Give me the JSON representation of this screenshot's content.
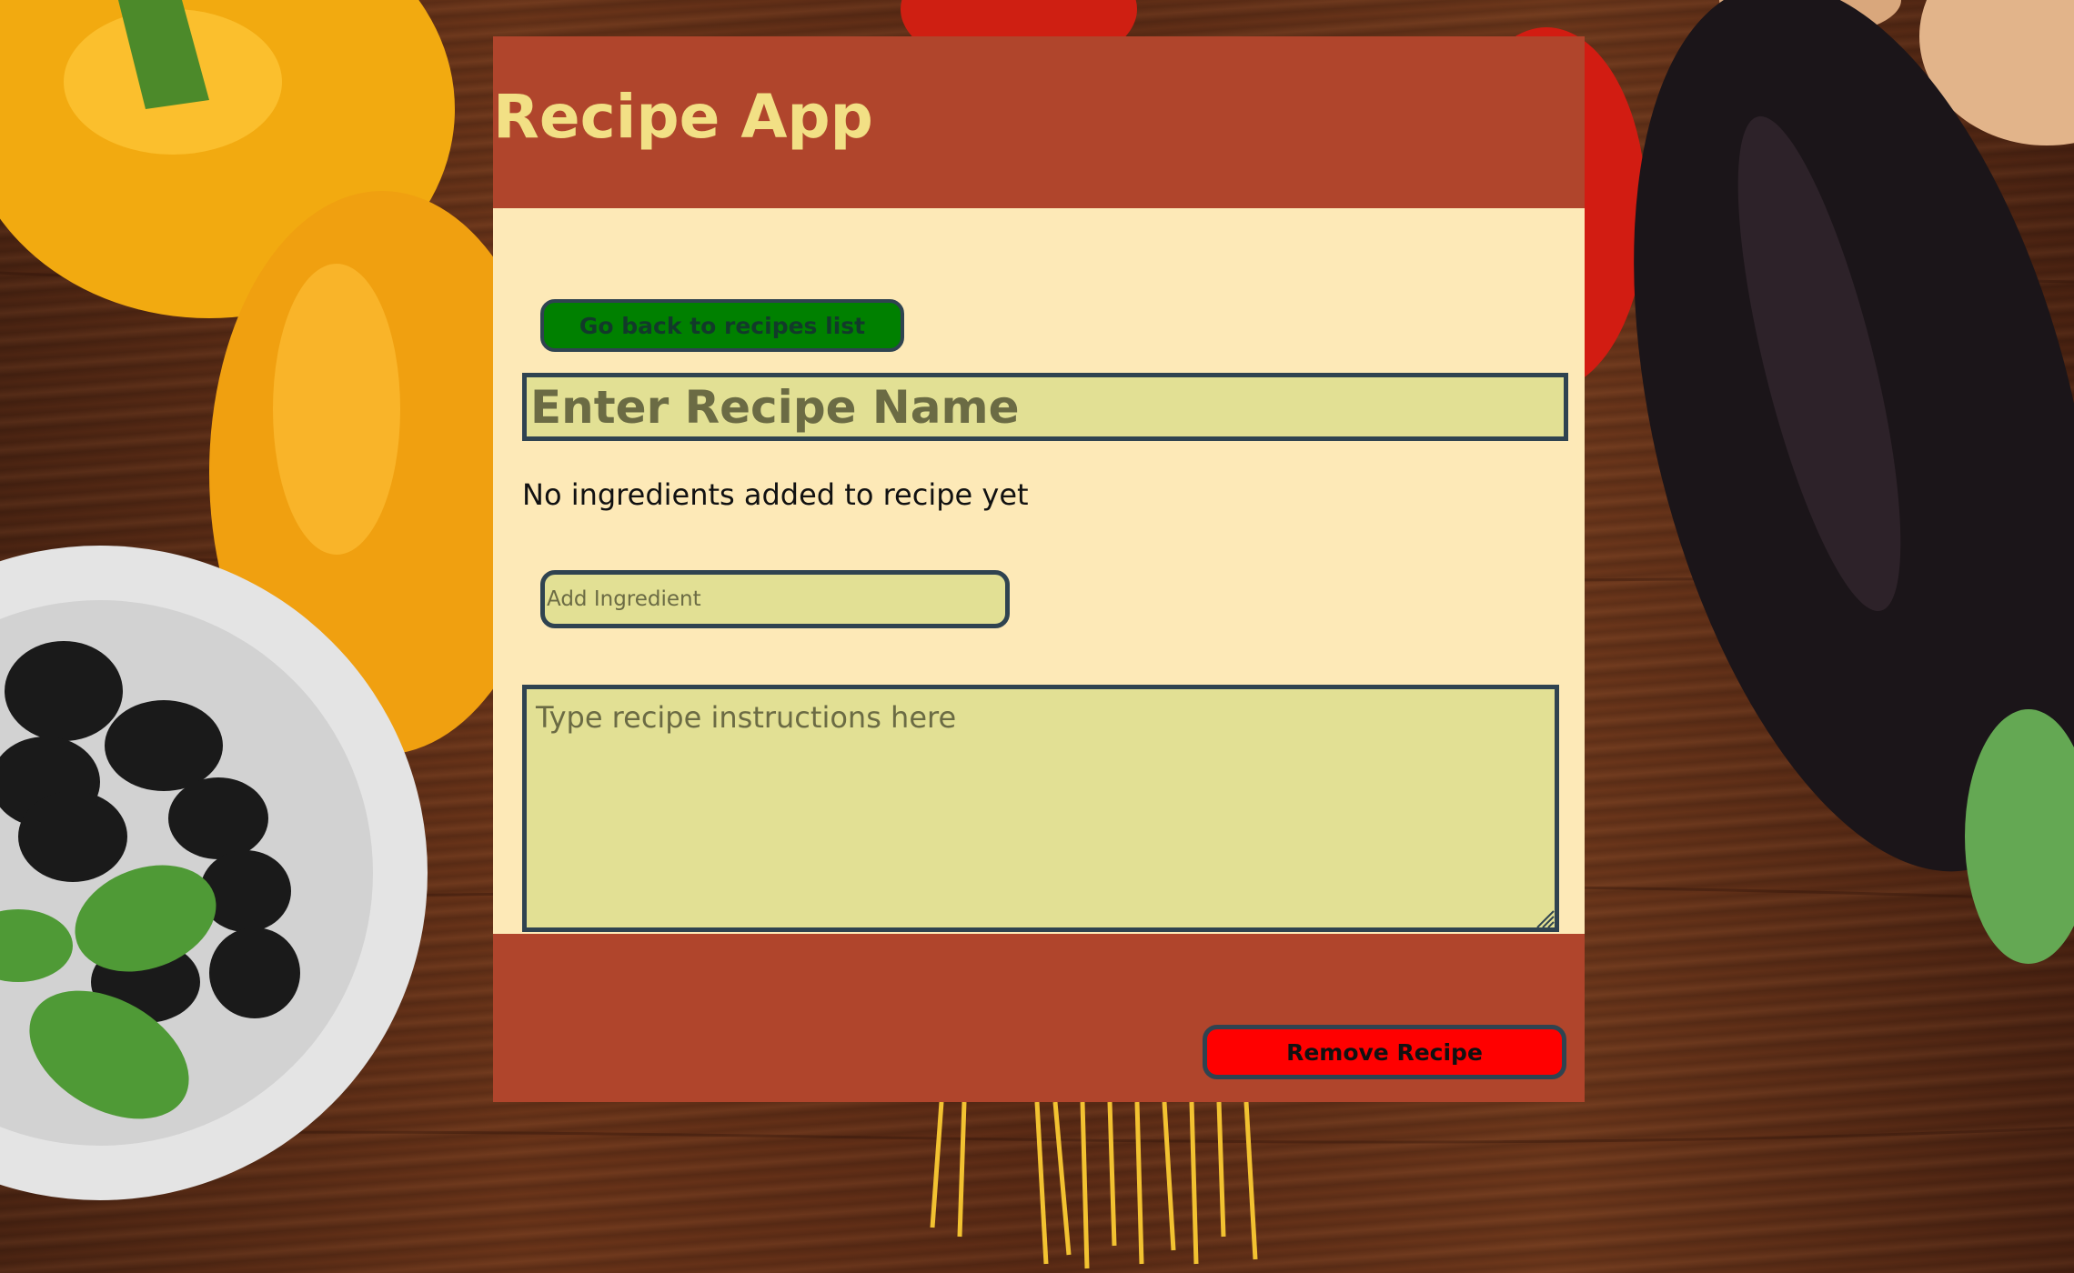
{
  "app": {
    "title": "Recipe App"
  },
  "nav": {
    "back_label": "Go back to recipes list"
  },
  "recipe": {
    "name_value": "",
    "name_placeholder": "Enter Recipe Name",
    "ingredients_empty_text": "No ingredients added to recipe yet",
    "ingredient_value": "",
    "ingredient_placeholder": "Add Ingredient",
    "instructions_value": "",
    "instructions_placeholder": "Type recipe instructions here"
  },
  "actions": {
    "remove_label": "Remove Recipe"
  },
  "colors": {
    "header_bg": "#b0452c",
    "body_bg": "#fde9b7",
    "title_text": "#f2e085",
    "input_bg": "#e2e094",
    "input_border": "#2f4350",
    "back_button_bg": "#008000",
    "remove_button_bg": "#ff0000"
  },
  "icons": {
    "resize_grip": "resize-grip-icon"
  }
}
